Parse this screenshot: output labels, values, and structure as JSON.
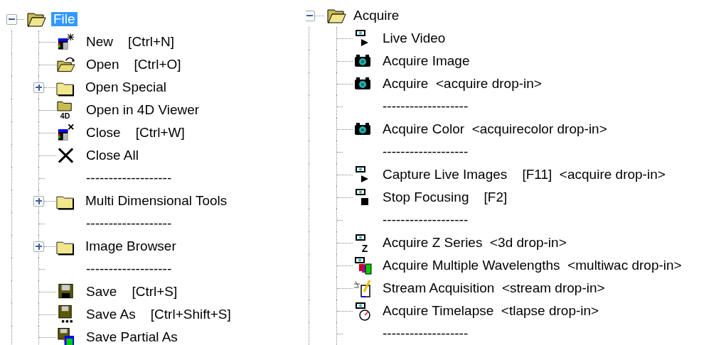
{
  "panes": [
    {
      "root": {
        "label": "File",
        "expanded": true,
        "selected": true,
        "children": [
          {
            "kind": "command",
            "label": "New    [Ctrl+N]",
            "selected": false
          },
          {
            "kind": "command",
            "label": "Open    [Ctrl+O]",
            "selected": false
          },
          {
            "kind": "folder",
            "label": "Open Special",
            "expanded": false,
            "selected": false
          },
          {
            "kind": "command",
            "label": "Open in 4D Viewer",
            "icon_text": "4D",
            "selected": false
          },
          {
            "kind": "command",
            "label": "Close    [Ctrl+W]",
            "selected": false
          },
          {
            "kind": "command",
            "label": "Close All",
            "selected": false
          },
          {
            "kind": "separator",
            "label": "-------------------"
          },
          {
            "kind": "folder",
            "label": "Multi Dimensional Tools",
            "expanded": false,
            "selected": false
          },
          {
            "kind": "separator",
            "label": "-------------------"
          },
          {
            "kind": "folder",
            "label": "Image Browser",
            "expanded": false,
            "selected": false
          },
          {
            "kind": "separator",
            "label": "-------------------"
          },
          {
            "kind": "command",
            "label": "Save    [Ctrl+S]",
            "selected": false
          },
          {
            "kind": "command",
            "label": "Save As    [Ctrl+Shift+S]",
            "selected": false
          },
          {
            "kind": "command",
            "label": "Save Partial As",
            "selected": false
          }
        ]
      }
    },
    {
      "root": {
        "label": "Acquire",
        "expanded": true,
        "selected": false,
        "children": [
          {
            "kind": "command",
            "label": "Live Video",
            "selected": false
          },
          {
            "kind": "command",
            "label": "Acquire Image",
            "selected": false
          },
          {
            "kind": "command",
            "label": "Acquire  <acquire drop-in>",
            "selected": false
          },
          {
            "kind": "separator",
            "label": "-------------------"
          },
          {
            "kind": "command",
            "label": "Acquire Color  <acquirecolor drop-in>",
            "selected": false
          },
          {
            "kind": "separator",
            "label": "-------------------"
          },
          {
            "kind": "command",
            "label": "Capture Live Images    [F11]  <acquire drop-in>",
            "selected": false
          },
          {
            "kind": "command",
            "label": "Stop Focusing    [F2]",
            "selected": false
          },
          {
            "kind": "separator",
            "label": "-------------------"
          },
          {
            "kind": "command",
            "label": "Acquire Z Series  <3d drop-in>",
            "icon_text": "Z",
            "selected": false
          },
          {
            "kind": "command",
            "label": "Acquire Multiple Wavelengths  <multiwac drop-in>",
            "selected": false
          },
          {
            "kind": "command",
            "label": "Stream Acquisition  <stream drop-in>",
            "selected": false
          },
          {
            "kind": "command",
            "label": "Acquire Timelapse  <tlapse drop-in>",
            "selected": false
          },
          {
            "kind": "separator",
            "label": "-------------------"
          }
        ]
      }
    }
  ]
}
